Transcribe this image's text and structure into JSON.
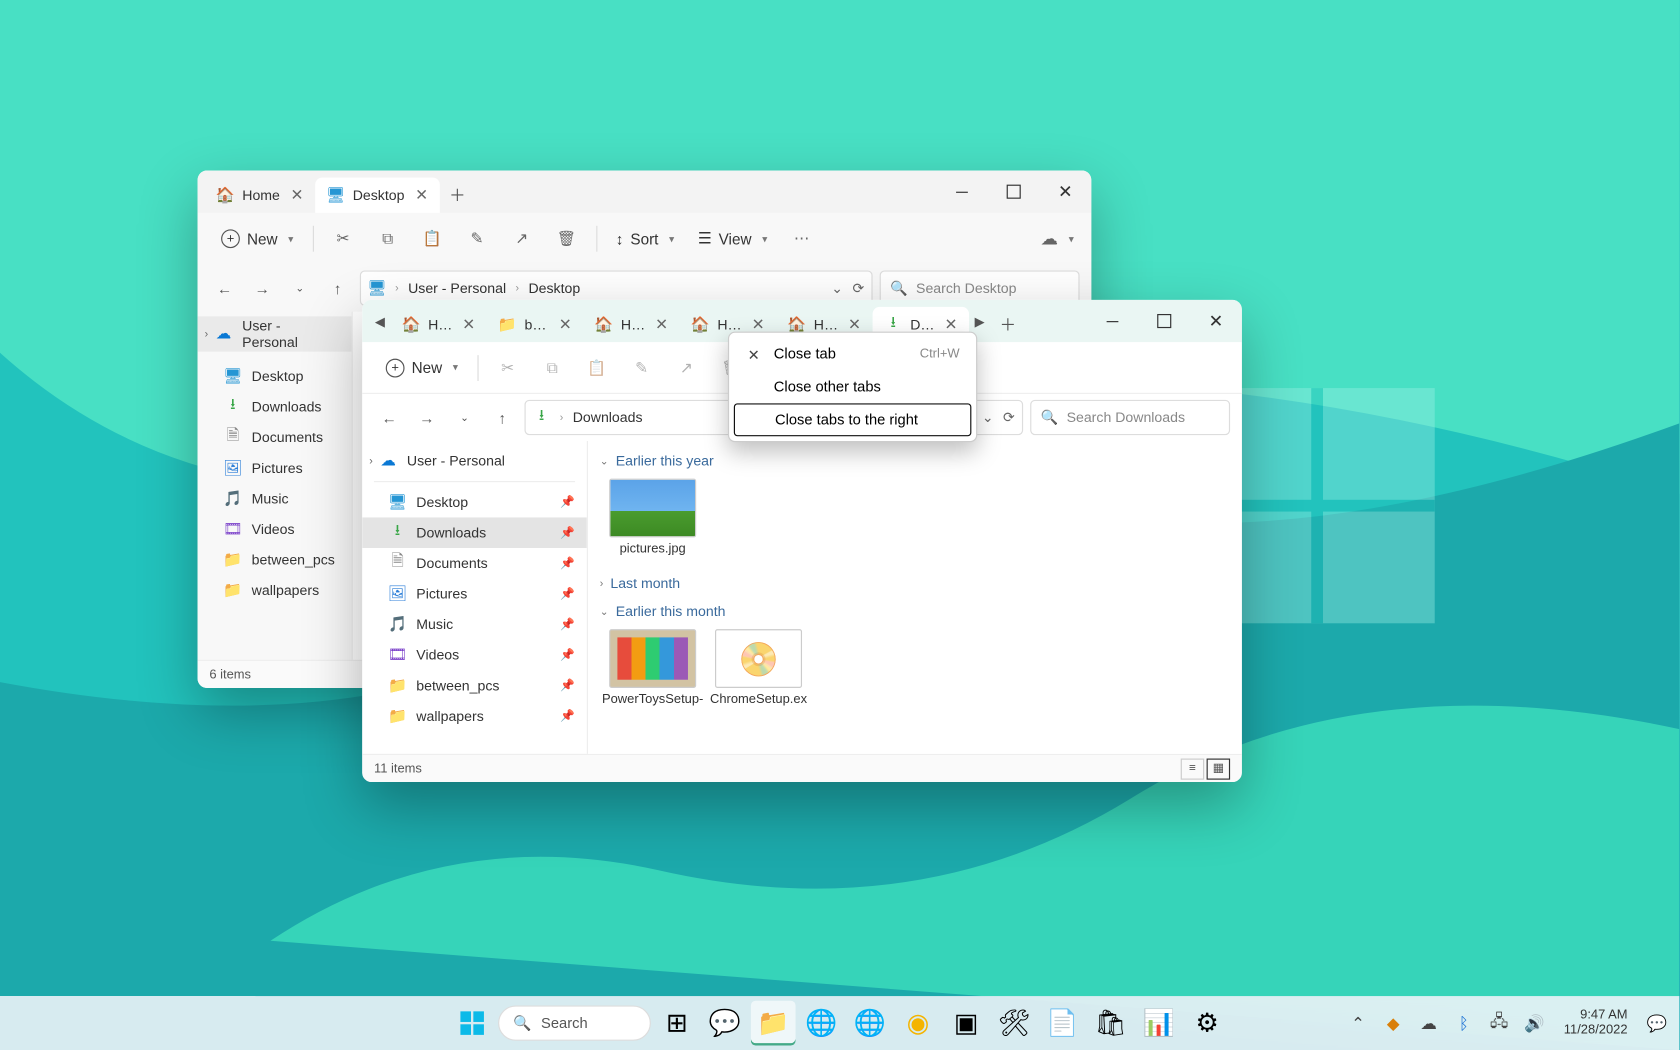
{
  "win_back": {
    "tabs": [
      {
        "label": "Home",
        "active": false
      },
      {
        "label": "Desktop",
        "active": true
      }
    ],
    "toolbar": {
      "new_label": "New",
      "sort_label": "Sort",
      "view_label": "View"
    },
    "breadcrumb": [
      "User - Personal",
      "Desktop"
    ],
    "search_placeholder": "Search Desktop",
    "sidebar": {
      "root": "User - Personal",
      "items": [
        "Desktop",
        "Downloads",
        "Documents",
        "Pictures",
        "Music",
        "Videos",
        "between_pcs",
        "wallpapers"
      ]
    },
    "status": "6 items"
  },
  "win_front": {
    "tabs": [
      {
        "label": "Hom",
        "kind": "home"
      },
      {
        "label": "betw",
        "kind": "folder"
      },
      {
        "label": "Hom",
        "kind": "home"
      },
      {
        "label": "Hom",
        "kind": "home"
      },
      {
        "label": "Hom",
        "kind": "home"
      },
      {
        "label": "Dow",
        "kind": "dl",
        "active": true
      }
    ],
    "toolbar": {
      "new_label": "New"
    },
    "address_icon": "dl",
    "address": "Downloads",
    "search_placeholder": "Search Downloads",
    "sidebar": {
      "root": "User - Personal",
      "items": [
        {
          "label": "Desktop",
          "icon": "monitor"
        },
        {
          "label": "Downloads",
          "icon": "dl",
          "selected": true
        },
        {
          "label": "Documents",
          "icon": "doc"
        },
        {
          "label": "Pictures",
          "icon": "pic"
        },
        {
          "label": "Music",
          "icon": "music"
        },
        {
          "label": "Videos",
          "icon": "vid"
        },
        {
          "label": "between_pcs",
          "icon": "folder"
        },
        {
          "label": "wallpapers",
          "icon": "folder"
        }
      ]
    },
    "groups": [
      {
        "title": "Earlier this year",
        "expanded": true,
        "items": [
          {
            "name": "pictures.jpg",
            "thumb": "bliss"
          }
        ]
      },
      {
        "title": "Last month",
        "expanded": false,
        "items": []
      },
      {
        "title": "Earlier this month",
        "expanded": true,
        "items": [
          {
            "name": "PowerToysSetup-",
            "thumb": "app"
          },
          {
            "name": "ChromeSetup.ex",
            "thumb": "installer"
          }
        ]
      }
    ],
    "status": "11 items"
  },
  "context_menu": [
    {
      "label": "Close tab",
      "shortcut": "Ctrl+W",
      "icon": "✕"
    },
    {
      "label": "Close other tabs"
    },
    {
      "label": "Close tabs to the right",
      "selected": true
    }
  ],
  "taskbar": {
    "search": "Search",
    "time": "9:47 AM",
    "date": "11/28/2022"
  }
}
